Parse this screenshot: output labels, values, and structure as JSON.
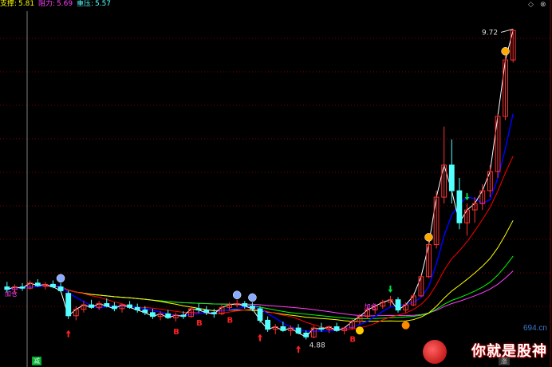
{
  "header": {
    "support_label": "支撑:",
    "support_value": "5.81",
    "resistance_label": "阻力:",
    "resistance_value": "5.69",
    "pressure_label": "重压:",
    "pressure_value": "5.57"
  },
  "window": {
    "btn_up": "◇",
    "btn_close": "⊗"
  },
  "annotations": {
    "high_price": "9.72",
    "low_price": "4.88",
    "add_position": "加仓",
    "add_position_2": "加仓",
    "buy_marker": "B"
  },
  "bottom": {
    "left_tag": "减",
    "right_tag": "涨"
  },
  "watermark": {
    "domain": "694.cn",
    "text": "你就是股神"
  },
  "colors": {
    "up": "#ff3232",
    "down": "#54ffff",
    "ma_white": "#ffffff",
    "ma_yellow": "#ffff00",
    "ma_blue": "#0000ff",
    "ma_red": "#ff0000",
    "ma_green": "#00ff00",
    "ma_magenta": "#ff40ff",
    "grid": "#800000",
    "cursor": "#808080"
  },
  "chart_data": {
    "type": "candlestick",
    "series": [
      {
        "name": "candles",
        "values": [
          [
            5.7,
            5.78,
            5.62,
            5.66
          ],
          [
            5.66,
            5.74,
            5.6,
            5.7
          ],
          [
            5.7,
            5.76,
            5.64,
            5.68
          ],
          [
            5.68,
            5.8,
            5.66,
            5.76
          ],
          [
            5.76,
            5.82,
            5.7,
            5.72
          ],
          [
            5.72,
            5.78,
            5.66,
            5.74
          ],
          [
            5.74,
            5.8,
            5.68,
            5.7
          ],
          [
            5.7,
            5.76,
            5.62,
            5.64
          ],
          [
            5.6,
            5.64,
            5.2,
            5.25
          ],
          [
            5.25,
            5.4,
            5.18,
            5.35
          ],
          [
            5.35,
            5.48,
            5.3,
            5.42
          ],
          [
            5.42,
            5.5,
            5.36,
            5.38
          ],
          [
            5.38,
            5.48,
            5.34,
            5.44
          ],
          [
            5.44,
            5.52,
            5.38,
            5.4
          ],
          [
            5.4,
            5.46,
            5.32,
            5.36
          ],
          [
            5.36,
            5.44,
            5.3,
            5.42
          ],
          [
            5.42,
            5.48,
            5.36,
            5.38
          ],
          [
            5.38,
            5.44,
            5.3,
            5.34
          ],
          [
            5.34,
            5.4,
            5.26,
            5.3
          ],
          [
            5.3,
            5.36,
            5.2,
            5.24
          ],
          [
            5.24,
            5.32,
            5.18,
            5.28
          ],
          [
            5.28,
            5.34,
            5.2,
            5.22
          ],
          [
            5.22,
            5.3,
            5.16,
            5.26
          ],
          [
            5.26,
            5.32,
            5.2,
            5.24
          ],
          [
            5.24,
            5.4,
            5.22,
            5.36
          ],
          [
            5.36,
            5.44,
            5.3,
            5.34
          ],
          [
            5.34,
            5.4,
            5.26,
            5.3
          ],
          [
            5.3,
            5.36,
            5.22,
            5.28
          ],
          [
            5.28,
            5.42,
            5.26,
            5.38
          ],
          [
            5.38,
            5.46,
            5.34,
            5.42
          ],
          [
            5.42,
            5.5,
            5.38,
            5.44
          ],
          [
            5.44,
            5.48,
            5.36,
            5.4
          ],
          [
            5.4,
            5.46,
            5.32,
            5.36
          ],
          [
            5.36,
            5.4,
            5.14,
            5.18
          ],
          [
            5.18,
            5.24,
            5.0,
            5.04
          ],
          [
            5.04,
            5.12,
            4.96,
            5.08
          ],
          [
            5.08,
            5.16,
            5.0,
            5.02
          ],
          [
            5.02,
            5.1,
            4.94,
            5.06
          ],
          [
            5.06,
            5.12,
            4.96,
            4.98
          ],
          [
            4.98,
            5.02,
            4.88,
            4.92
          ],
          [
            4.92,
            5.1,
            4.9,
            5.06
          ],
          [
            5.06,
            5.14,
            5.0,
            5.04
          ],
          [
            5.04,
            5.1,
            4.98,
            5.08
          ],
          [
            5.08,
            5.14,
            5.0,
            5.02
          ],
          [
            5.02,
            5.08,
            4.96,
            5.06
          ],
          [
            5.06,
            5.2,
            5.04,
            5.16
          ],
          [
            5.16,
            5.28,
            5.12,
            5.24
          ],
          [
            5.24,
            5.38,
            5.2,
            5.34
          ],
          [
            5.34,
            5.44,
            5.28,
            5.4
          ],
          [
            5.4,
            5.5,
            5.36,
            5.46
          ],
          [
            5.46,
            5.56,
            5.4,
            5.5
          ],
          [
            5.5,
            5.54,
            5.3,
            5.34
          ],
          [
            5.34,
            5.46,
            5.3,
            5.42
          ],
          [
            5.42,
            5.6,
            5.4,
            5.56
          ],
          [
            5.56,
            5.9,
            5.54,
            5.86
          ],
          [
            5.86,
            6.4,
            5.84,
            6.36
          ],
          [
            6.36,
            7.2,
            6.3,
            7.1
          ],
          [
            7.1,
            8.2,
            7.0,
            7.6
          ],
          [
            7.6,
            8.0,
            7.0,
            7.2
          ],
          [
            7.2,
            7.4,
            6.6,
            6.7
          ],
          [
            6.7,
            7.0,
            6.5,
            6.9
          ],
          [
            6.9,
            7.1,
            6.7,
            7.0
          ],
          [
            7.0,
            7.3,
            6.9,
            7.2
          ],
          [
            7.2,
            7.6,
            7.1,
            7.5
          ],
          [
            7.5,
            8.4,
            7.4,
            8.36
          ],
          [
            8.36,
            9.3,
            8.3,
            9.24
          ],
          [
            9.24,
            9.72,
            9.2,
            9.7
          ]
        ]
      }
    ],
    "ylim": [
      4.7,
      10.0
    ],
    "grid": true,
    "high_label": "9.72",
    "low_label": "4.88"
  }
}
